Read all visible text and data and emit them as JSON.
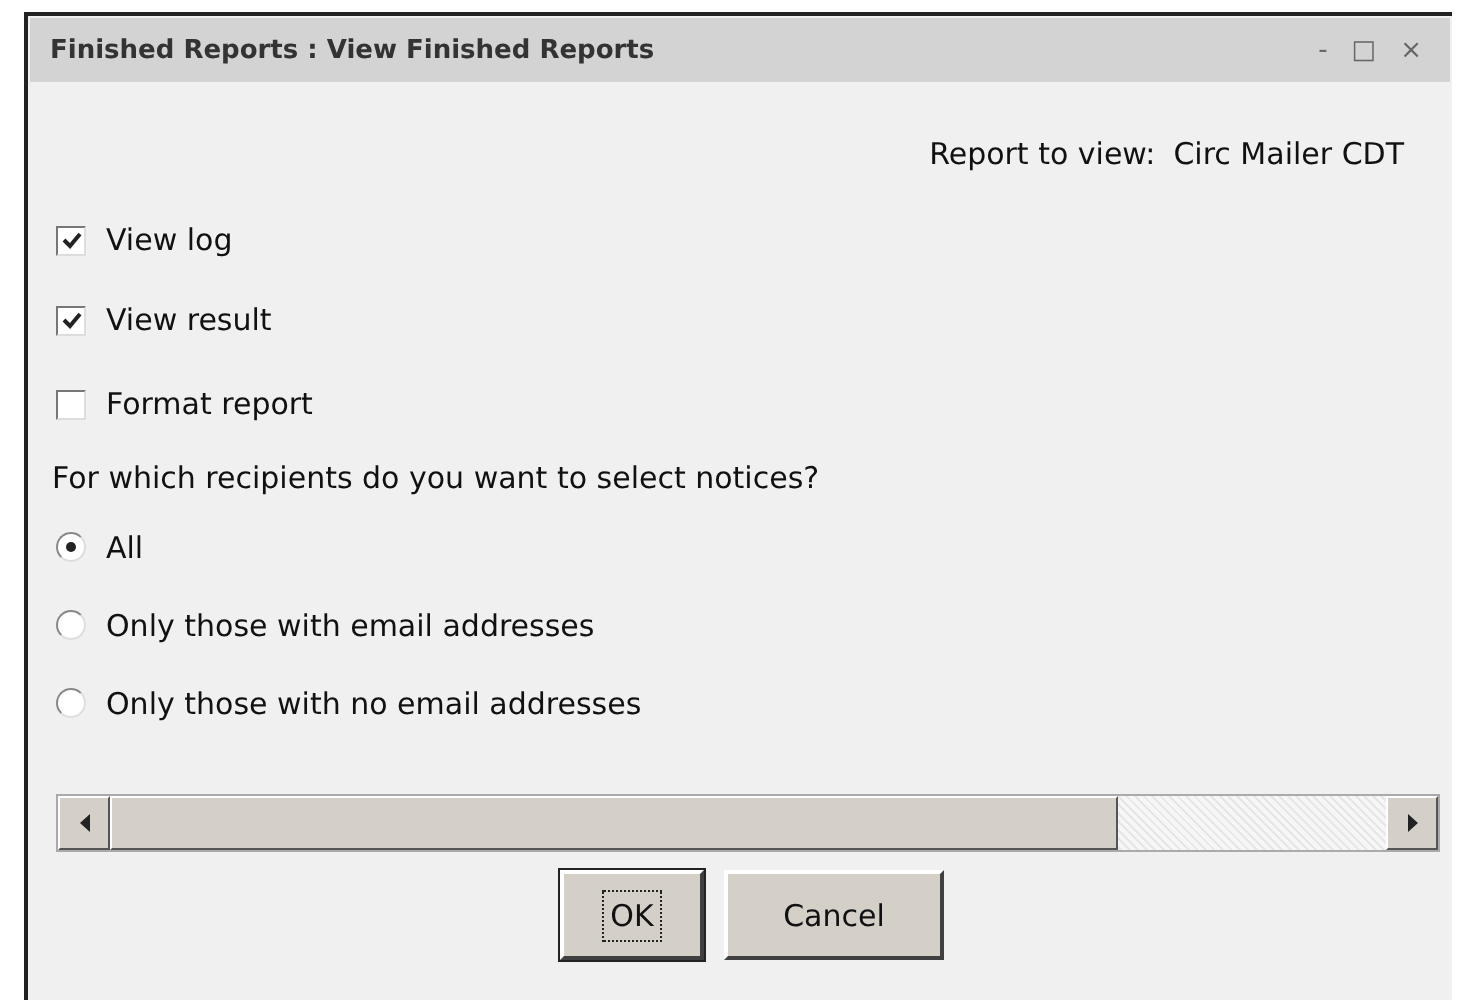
{
  "window": {
    "title": "Finished Reports : View Finished Reports",
    "controls": [
      "-",
      "□",
      "×"
    ]
  },
  "report": {
    "label": "Report to view:",
    "value": "Circ Mailer CDT"
  },
  "options": [
    {
      "label": "View log",
      "checked": true
    },
    {
      "label": "View result",
      "checked": true
    },
    {
      "label": "Format report",
      "checked": false
    }
  ],
  "question": "For which recipients do you want to select notices?",
  "recipients": [
    {
      "label": "All",
      "selected": true
    },
    {
      "label": "Only those with email addresses",
      "selected": false
    },
    {
      "label": "Only those with no email addresses",
      "selected": false
    }
  ],
  "buttons": [
    {
      "label": "OK",
      "focused": true
    },
    {
      "label": "Cancel",
      "focused": false
    }
  ]
}
